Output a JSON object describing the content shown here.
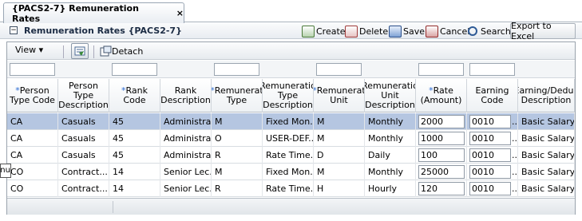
{
  "tab": {
    "title": "{PACS2-7} Remuneration Rates",
    "close": "×"
  },
  "panel": {
    "title": "Remuneration Rates {PACS2-7}",
    "collapse": "−"
  },
  "toolbar": {
    "create": "Create",
    "delete": "Delete",
    "save": "Save",
    "cancel": "Cancel",
    "search": "Search",
    "export": "Export to Excel"
  },
  "gridtoolbar": {
    "view": "View ▾",
    "detach": "Detach"
  },
  "columns": [
    {
      "required": true,
      "label": "Person\nType Code"
    },
    {
      "required": false,
      "label": "Person\nType\nDescription"
    },
    {
      "required": true,
      "label": "Rank\nCode"
    },
    {
      "required": false,
      "label": "Rank\nDescription"
    },
    {
      "required": true,
      "label": "Remunerat\nType"
    },
    {
      "required": false,
      "label": "Remuneratio\nType\nDescription"
    },
    {
      "required": true,
      "label": "Remunerat\nUnit"
    },
    {
      "required": false,
      "label": "Remuneratio\nUnit\nDescription"
    },
    {
      "required": true,
      "label": "Rate\n(Amount)"
    },
    {
      "required": false,
      "label": "Earning\nCode"
    },
    {
      "required": false,
      "label": "Earning/Deduc\nDescription"
    }
  ],
  "rows": [
    {
      "c": [
        "CA",
        "Casuals",
        "45",
        "Administra...",
        "M",
        "Fixed Mon...",
        "M",
        "Monthly",
        "2000",
        "0010",
        "Basic Salary"
      ]
    },
    {
      "c": [
        "CA",
        "Casuals",
        "45",
        "Administra...",
        "O",
        "USER-DEF...",
        "M",
        "Monthly",
        "1000",
        "0010",
        "Basic Salary"
      ]
    },
    {
      "c": [
        "CA",
        "Casuals",
        "45",
        "Administra...",
        "R",
        "Rate Time...",
        "D",
        "Daily",
        "100",
        "0010",
        "Basic Salary"
      ]
    },
    {
      "c": [
        "CO",
        "Contract...",
        "14",
        "Senior Lec...",
        "M",
        "Fixed Mon...",
        "M",
        "Monthly",
        "25000",
        "0010",
        "Basic Salary"
      ]
    },
    {
      "c": [
        "CO",
        "Contract...",
        "14",
        "Senior Lec...",
        "R",
        "Rate Time...",
        "H",
        "Hourly",
        "120",
        "0010",
        "Basic Salary"
      ]
    }
  ],
  "selected_row": 0,
  "more_glyph": "...",
  "required_marker": "*",
  "tooltip": "Menu"
}
